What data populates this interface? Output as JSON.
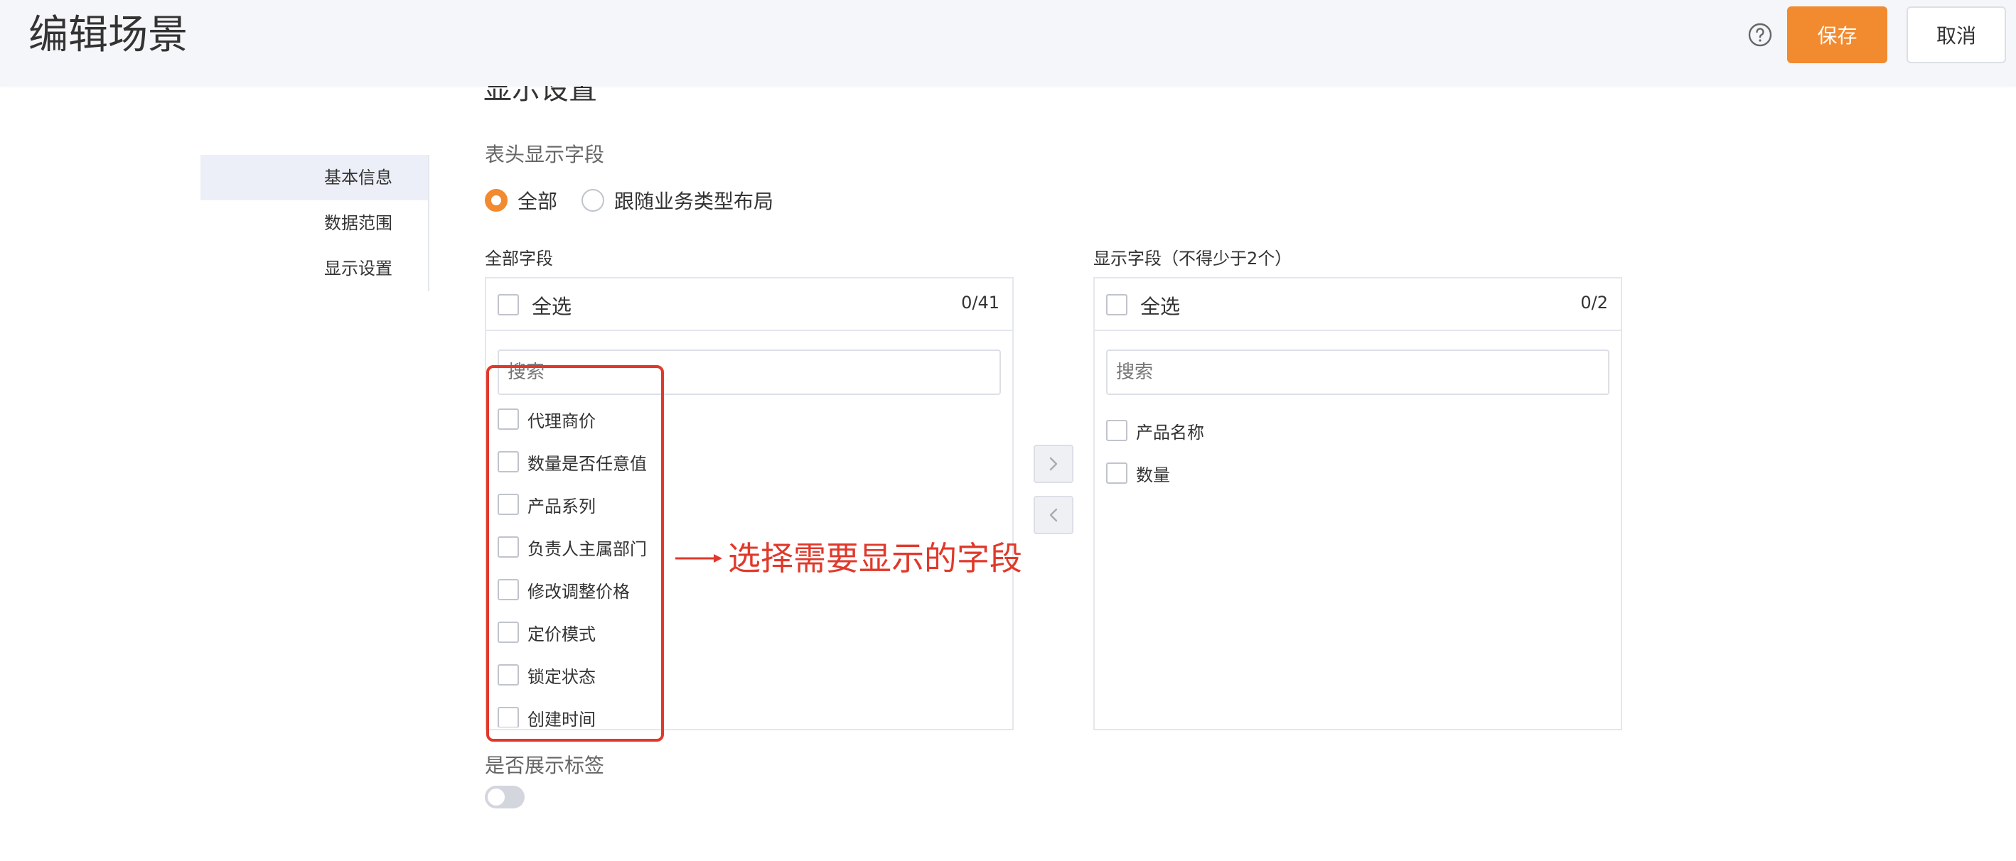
{
  "header": {
    "title": "编辑场景",
    "help_icon": "question-circle-icon",
    "save_label": "保存",
    "cancel_label": "取消",
    "accent_color": "#f28a2f"
  },
  "section": {
    "title": "显示设置",
    "header_fields_label": "表头显示字段",
    "tag_display_label": "是否展示标签",
    "tag_display_enabled": false
  },
  "nav": {
    "items": [
      {
        "label": "基本信息",
        "active": true
      },
      {
        "label": "数据范围",
        "active": false
      },
      {
        "label": "显示设置",
        "active": false
      }
    ]
  },
  "radio": {
    "options": [
      {
        "label": "全部",
        "checked": true
      },
      {
        "label": "跟随业务类型布局",
        "checked": false
      }
    ]
  },
  "transfer": {
    "left": {
      "title": "全部字段",
      "select_all_label": "全选",
      "count": "0/41",
      "search_placeholder": "搜索",
      "items": [
        "代理商价",
        "数量是否任意值",
        "产品系列",
        "负责人主属部门",
        "修改调整价格",
        "定价模式",
        "锁定状态",
        "创建时间"
      ]
    },
    "right": {
      "title": "显示字段（不得少于2个）",
      "select_all_label": "全选",
      "count": "0/2",
      "search_placeholder": "搜索",
      "items": [
        "产品名称",
        "数量"
      ]
    },
    "move_right_icon": "chevron-right-icon",
    "move_left_icon": "chevron-left-icon"
  },
  "annotation": {
    "text": "选择需要显示的字段",
    "color": "#e0392b"
  }
}
